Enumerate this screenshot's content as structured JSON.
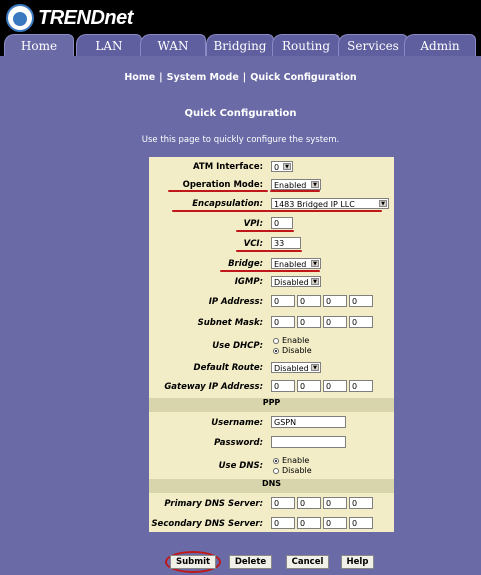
{
  "brand": {
    "name": "TRENDnet"
  },
  "tabs": [
    {
      "label": "Home"
    },
    {
      "label": "LAN"
    },
    {
      "label": "WAN"
    },
    {
      "label": "Bridging"
    },
    {
      "label": "Routing"
    },
    {
      "label": "Services"
    },
    {
      "label": "Admin"
    }
  ],
  "breadcrumb": {
    "home": "Home",
    "system_mode": "System Mode",
    "quick_config": "Quick Configuration"
  },
  "page": {
    "title": "Quick Configuration",
    "subtitle": "Use this page to quickly configure the system."
  },
  "form": {
    "atm_interface": {
      "label": "ATM Interface:",
      "value": "0"
    },
    "operation_mode": {
      "label": "Operation Mode:",
      "value": "Enabled"
    },
    "encapsulation": {
      "label": "Encapsulation:",
      "value": "1483 Bridged IP LLC"
    },
    "vpi": {
      "label": "VPI:",
      "value": "0"
    },
    "vci": {
      "label": "VCI:",
      "value": "33"
    },
    "bridge": {
      "label": "Bridge:",
      "value": "Enabled"
    },
    "igmp": {
      "label": "IGMP:",
      "value": "Disabled"
    },
    "ip_address": {
      "label": "IP Address:",
      "octets": [
        "0",
        "0",
        "0",
        "0"
      ]
    },
    "subnet_mask": {
      "label": "Subnet Mask:",
      "octets": [
        "0",
        "0",
        "0",
        "0"
      ]
    },
    "use_dhcp": {
      "label": "Use DHCP:",
      "enable": "Enable",
      "disable": "Disable",
      "selected": "Disable"
    },
    "default_route": {
      "label": "Default Route:",
      "value": "Disabled"
    },
    "gateway_ip": {
      "label": "Gateway IP Address:",
      "octets": [
        "0",
        "0",
        "0",
        "0"
      ]
    },
    "ppp_section": "PPP",
    "username": {
      "label": "Username:",
      "value": "GSPN"
    },
    "password": {
      "label": "Password:",
      "value": ""
    },
    "use_dns": {
      "label": "Use DNS:",
      "enable": "Enable",
      "disable": "Disable",
      "selected": "Enable"
    },
    "dns_section": "DNS",
    "primary_dns": {
      "label": "Primary DNS Server:",
      "octets": [
        "0",
        "0",
        "0",
        "0"
      ]
    },
    "secondary_dns": {
      "label": "Secondary DNS Server:",
      "octets": [
        "0",
        "0",
        "0",
        "0"
      ]
    }
  },
  "buttons": {
    "submit": "Submit",
    "delete": "Delete",
    "cancel": "Cancel",
    "help": "Help"
  },
  "colors": {
    "background": "#6a6aa6",
    "form": "#f2edc6",
    "annotation": "#c0181a"
  }
}
